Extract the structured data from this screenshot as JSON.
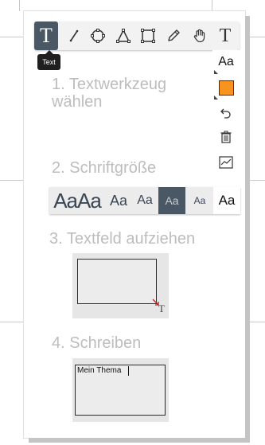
{
  "toolbar": {
    "tools": [
      {
        "name": "text-tool",
        "icon": "text-T-icon"
      },
      {
        "name": "line-tool",
        "icon": "line-icon"
      },
      {
        "name": "circle-tool",
        "icon": "circle-icon"
      },
      {
        "name": "triangle-tool",
        "icon": "triangle-icon"
      },
      {
        "name": "rectangle-tool",
        "icon": "rectangle-icon"
      },
      {
        "name": "pencil-tool",
        "icon": "pencil-icon"
      },
      {
        "name": "hand-tool",
        "icon": "hand-icon"
      },
      {
        "name": "text-tool-2",
        "icon": "text-T-icon"
      }
    ],
    "tooltip": "Text",
    "text_glyph": "T"
  },
  "sidebar": {
    "font_size_label": "Aa",
    "color": "#f7931e"
  },
  "steps": {
    "step1": "1. Textwerkzeug\nwählen",
    "step2": "2. Schriftgröße",
    "step3": "3. Textfeld aufziehen",
    "step4": "4. Schreiben"
  },
  "size_options": [
    "AaAa",
    "Aa",
    "Aa",
    "Aa",
    "Aa",
    "Aa"
  ],
  "demo": {
    "text": "Mein Thema",
    "cursor_glyph": "T"
  },
  "colors": {
    "accent": "#4a5866",
    "step_text": "#bdbdbd",
    "swatch": "#f7931e"
  }
}
